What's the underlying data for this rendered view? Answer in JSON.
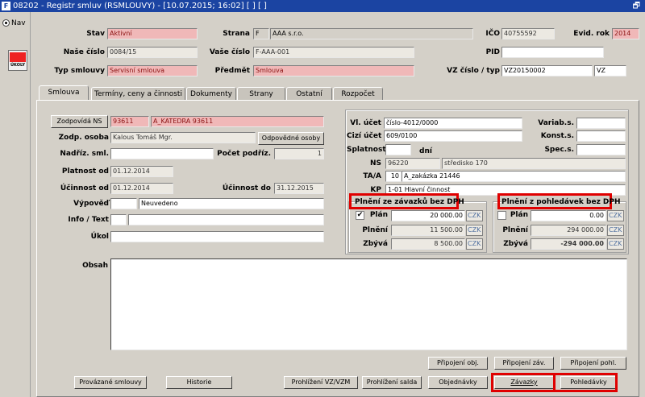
{
  "window": {
    "title": "08202 - Registr smluv (RSMLOUVY) - [10.07.2015; 16:02] [ ] [ ]",
    "restore_glyph": "🗗"
  },
  "side": {
    "nav_label": "Nav",
    "ukoly_label": "ÚKOLY"
  },
  "header": {
    "stav_label": "Stav",
    "stav": "Aktivní",
    "strana_label": "Strana",
    "strana_code": "F",
    "strana_name": "AAA s.r.o.",
    "ico_label": "IČO",
    "ico": "40755592",
    "evid_label": "Evid. rok",
    "evid": "2014",
    "nase_label": "Naše číslo",
    "nase": "0084/15",
    "vase_label": "Vaše číslo",
    "vase": "F-AAA-001",
    "pid_label": "PID",
    "pid": "",
    "typ_label": "Typ smlouvy",
    "typ": "Servisní smlouva",
    "predmet_label": "Předmět",
    "predmet": "Smlouva",
    "vz_label": "VZ číslo / typ",
    "vz": "VZ20150002",
    "vz_typ": "VZ"
  },
  "tabs": [
    "Smlouva",
    "Termíny, ceny a činnosti",
    "Dokumenty",
    "Strany",
    "Ostatní",
    "Rozpočet"
  ],
  "left": {
    "zodp_btn": "Zodpovídá NS",
    "zodp_ns": "93611",
    "zodp_name": "A_KATEDRA 93611",
    "osoba_label": "Zodp. osoba",
    "osoba": "Kalous Tomáš Mgr.",
    "odp_btn": "Odpovědné osoby",
    "nadriz_label": "Nadříz. sml.",
    "nadriz": "",
    "pocet_label": "Počet podříz.",
    "pocet": "1",
    "platnost_label": "Platnost od",
    "platnost": "01.12.2014",
    "ucinnost_label": "Účinnost od",
    "ucinnost": "01.12.2014",
    "ucinnost_do_label": "Účinnost do",
    "ucinnost_do": "31.12.2015",
    "vypoved_label": "Výpověď",
    "vypoved_code": "",
    "vypoved": "Neuvedeno",
    "info_label": "Info / Text",
    "info_code": "",
    "info": "",
    "ukol_label": "Úkol",
    "ukol": ""
  },
  "right": {
    "vl_label": "Vl. účet",
    "vl": "číslo-4012/0000",
    "variab_label": "Variab.s.",
    "variab": "",
    "cizi_label": "Cizí účet",
    "cizi": "609/0100",
    "konst_label": "Konst.s.",
    "konst": "",
    "splat_label": "Splatnost",
    "splat": "",
    "dni_label": "dní",
    "spec_label": "Spec.s.",
    "spec": "",
    "ns_label": "NS",
    "ns_code": "96220",
    "ns_name": "středisko 170",
    "taa_label": "TA/A",
    "taa_code": "10",
    "taa_name": "A_zakázka 21446",
    "kp_label": "KP",
    "kp": "1-01 Hlavní činnost"
  },
  "zavazky": {
    "title": "Plnění ze závazků bez DPH",
    "plan_label": "Plán",
    "plan": "20 000.00",
    "plan_checked": true,
    "plneni_label": "Plnění",
    "plneni": "11 500.00",
    "zbyva_label": "Zbývá",
    "zbyva": "8 500.00",
    "currency": "CZK",
    "check_glyph": "✔"
  },
  "pohledavky": {
    "title": "Plnění z pohledávek bez DPH",
    "plan_label": "Plán",
    "plan": "0.00",
    "plan_checked": false,
    "plneni_label": "Plnění",
    "plneni": "294 000.00",
    "zbyva_label": "Zbývá",
    "zbyva": "-294 000.00",
    "currency": "CZK"
  },
  "obsah_label": "Obsah",
  "obsah": "",
  "buttons": {
    "pripojeni_obj": "Připojení obj.",
    "pripojeni_zav": "Připojení záv.",
    "pripojeni_pohl": "Připojení pohl.",
    "provazane": "Provázané smlouvy",
    "historie": "Historie",
    "prohlizeni_vz": "Prohlížení VZ/VZM",
    "prohlizeni_salda": "Prohlížení salda",
    "objednavky": "Objednávky",
    "zavazky": "Závazky",
    "pohledavky": "Pohledávky"
  }
}
